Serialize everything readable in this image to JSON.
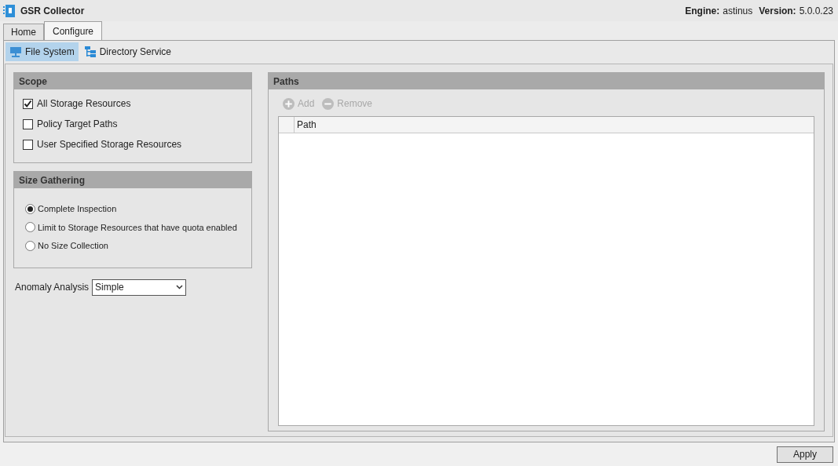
{
  "window": {
    "title": "GSR Collector",
    "engine_label": "Engine:",
    "engine": "astinus",
    "version_label": "Version:",
    "version": "5.0.0.23"
  },
  "tabs": [
    {
      "label": "Home",
      "selected": false
    },
    {
      "label": "Configure",
      "selected": true
    }
  ],
  "subtabs": [
    {
      "label": "File System",
      "selected": true,
      "kind": "monitor"
    },
    {
      "label": "Directory Service",
      "selected": false,
      "kind": "tree"
    }
  ],
  "scope": {
    "title": "Scope",
    "options": [
      {
        "label": "All Storage Resources",
        "checked": true
      },
      {
        "label": "Policy Target Paths",
        "checked": false
      },
      {
        "label": "User Specified Storage Resources",
        "checked": false
      }
    ]
  },
  "size_gathering": {
    "title": "Size Gathering",
    "options": [
      {
        "label": "Complete Inspection",
        "selected": true
      },
      {
        "label": "Limit to Storage Resources that have quota enabled",
        "selected": false
      },
      {
        "label": "No Size Collection",
        "selected": false
      }
    ]
  },
  "anomaly_analysis": {
    "label": "Anomaly Analysis",
    "value": "Simple"
  },
  "paths": {
    "title": "Paths",
    "buttons": [
      {
        "label": "Add",
        "kind": "add",
        "disabled": true
      },
      {
        "label": "Remove",
        "kind": "remove",
        "disabled": true
      }
    ],
    "columns": [
      "Path"
    ]
  },
  "footer": {
    "button": "Apply"
  }
}
